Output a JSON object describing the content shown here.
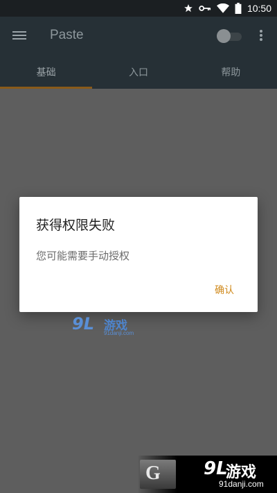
{
  "status_bar": {
    "time": "10:50",
    "icons": [
      "star-icon",
      "key-icon",
      "wifi-icon",
      "battery-icon"
    ]
  },
  "app_bar": {
    "title": "Paste",
    "toggle_on": false
  },
  "tabs": [
    {
      "label": "基础",
      "active": true
    },
    {
      "label": "入口",
      "active": false
    },
    {
      "label": "帮助",
      "active": false
    }
  ],
  "dialog": {
    "title": "获得权限失败",
    "message": "您可能需要手动授权",
    "confirm_label": "确认"
  },
  "watermark_center": {
    "logo": "9L",
    "text": "游戏",
    "url": "91danji.com"
  },
  "watermark_bottom": {
    "badge": "G",
    "logo": "9L",
    "text": "游戏",
    "url": "91danji.com"
  },
  "colors": {
    "app_bar": "#263036",
    "accent": "#d08a1c",
    "scrim": "#5e5e5e"
  }
}
